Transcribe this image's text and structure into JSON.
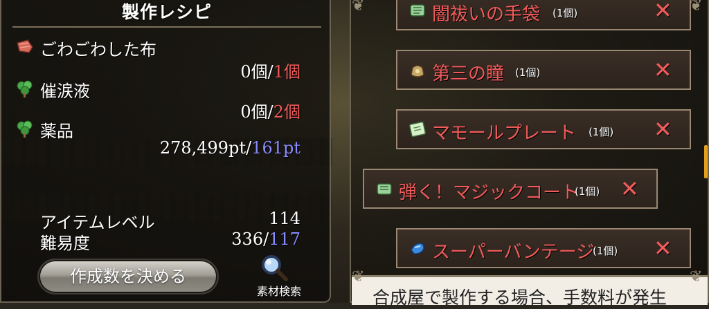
{
  "recipe_panel": {
    "title": "製作レシピ",
    "ingredients": [
      {
        "name": "ごわごわした布",
        "have": "0個/",
        "need": "1個",
        "icon": "cloth-icon"
      },
      {
        "name": "催涙液",
        "have": "0個/",
        "need": "2個",
        "icon": "herb-icon"
      },
      {
        "name": "薬品",
        "have": "278,499pt/",
        "need": "161pt",
        "icon": "herb-icon"
      }
    ],
    "stats": {
      "item_level_label": "アイテムレベル",
      "item_level_value": "114",
      "difficulty_label": "難易度",
      "difficulty_have": "336/",
      "difficulty_need": "117"
    },
    "make_button_label": "作成数を決める",
    "search_label": "素材検索"
  },
  "item_list": {
    "items": [
      {
        "name": "闇祓いの手袋",
        "qty": "(1個)",
        "remove": "✕"
      },
      {
        "name": "第三の瞳",
        "qty": "(1個)",
        "remove": "✕"
      },
      {
        "name": "マモールプレート",
        "qty": "(1個)",
        "remove": "✕"
      },
      {
        "name": "弾く！マジックコート",
        "qty": "(1個)",
        "remove": "✕"
      },
      {
        "name": "スーパーバンテージ",
        "qty": "(1個)",
        "remove": "✕"
      }
    ],
    "footer_text": "合成屋で製作する場合、手数料が発生"
  },
  "colors": {
    "need_red": "#f05a5a",
    "need_blue": "#8a8cff",
    "item_red": "#f25b5b"
  }
}
